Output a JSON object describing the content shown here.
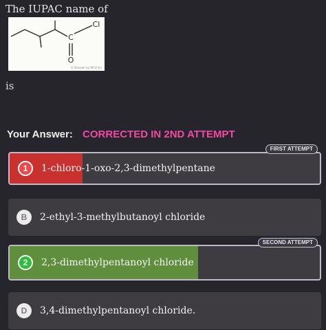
{
  "question": {
    "prefix": "The IUPAC name of",
    "suffix": "is",
    "structure": {
      "atom_cl": "Cl",
      "atom_c": "C",
      "atom_o": "O",
      "credit": "© Elsevier by MCQ Sci"
    }
  },
  "answer": {
    "label": "Your Answer:",
    "status": "CORRECTED IN 2ND ATTEMPT"
  },
  "options": [
    {
      "marker": "1",
      "text": "1-chloro-1-oxo-2,3-dimethylpentane",
      "state": "first-attempt-wrong",
      "tag": "FIRST ATTEMPT"
    },
    {
      "marker": "B",
      "text": "2-ethyl-3-methylbutanoyl chloride",
      "state": "neutral"
    },
    {
      "marker": "2",
      "text": "2,3-dimethylpentanoyl chloride",
      "state": "second-attempt-correct",
      "tag": "SECOND ATTEMPT"
    },
    {
      "marker": "D",
      "text": "3,4-dimethylpentanoyl chloride.",
      "state": "neutral"
    }
  ],
  "colors": {
    "background": "#26252b",
    "status_pink": "#f04aa6",
    "wrong_red": "#c9312f",
    "correct_green": "#5f8f3d"
  }
}
